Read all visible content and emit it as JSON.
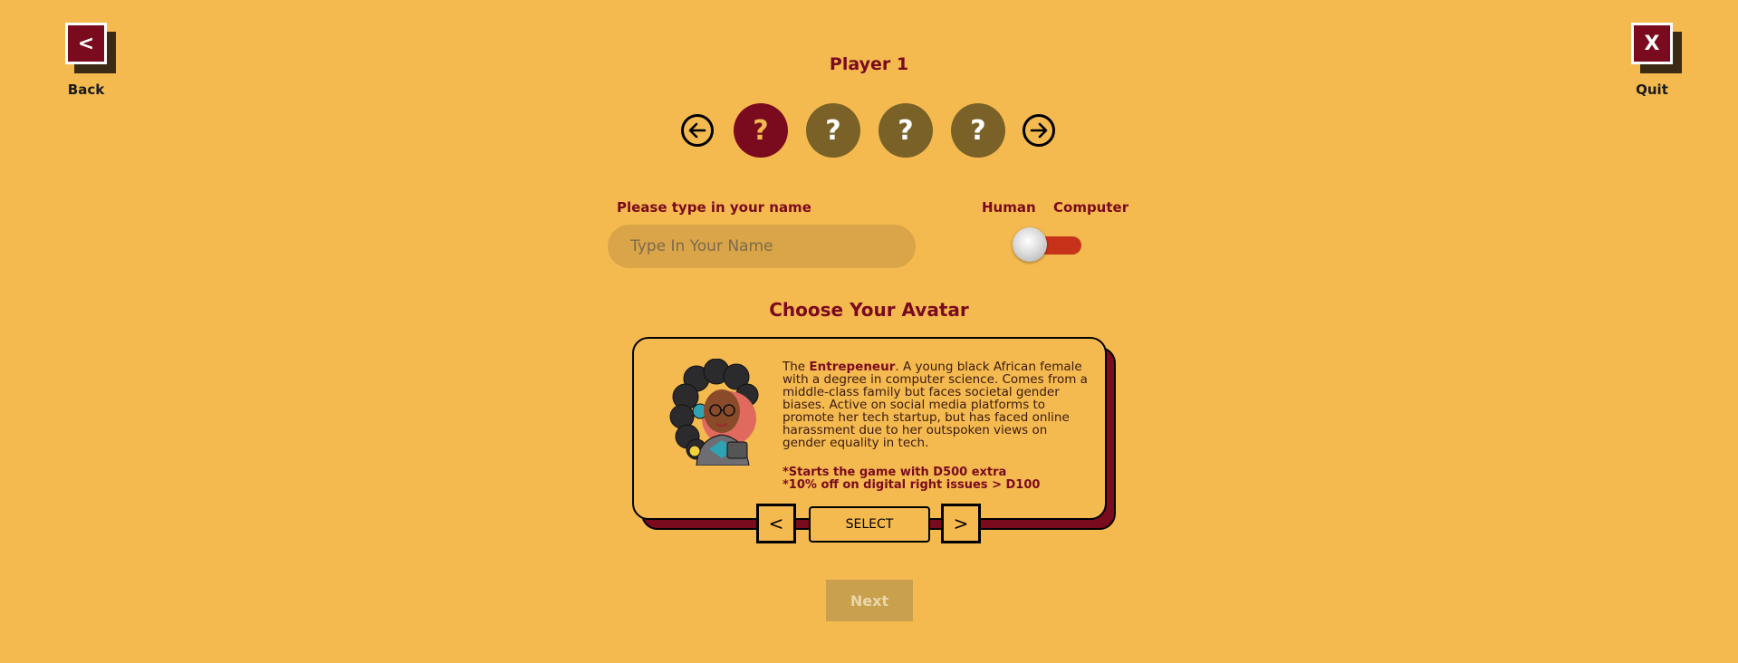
{
  "nav": {
    "back_label": "Back",
    "back_icon": "<",
    "quit_label": "Quit",
    "quit_icon": "X"
  },
  "player": {
    "title": "Player 1",
    "slots": [
      "?",
      "?",
      "?",
      "?"
    ],
    "active_slot": 0
  },
  "form": {
    "name_label": "Please type in your name",
    "name_placeholder": "Type In Your Name",
    "name_value": "",
    "toggle_left": "Human",
    "toggle_right": "Computer"
  },
  "avatar": {
    "section_title": "Choose Your Avatar",
    "desc_prefix": "The ",
    "name": "Entrepeneur",
    "description": ". A young black African female with a degree in computer science. Comes from a middle-class family but faces societal gender biases. Active on social media platforms to promote her tech startup, but has faced online harassment due to her outspoken views on gender equality in tech.",
    "perk_1": "*Starts the game with D500 extra",
    "perk_2": "*10% off on digital right issues > D100",
    "prev_label": "<",
    "select_label": "SELECT",
    "next_label": ">"
  },
  "footer": {
    "next_label": "Next"
  },
  "colors": {
    "background": "#F4BA4F",
    "accent": "#7A0A1E",
    "inactive_slot": "#7A6128",
    "toggle_track": "#C7331A"
  }
}
